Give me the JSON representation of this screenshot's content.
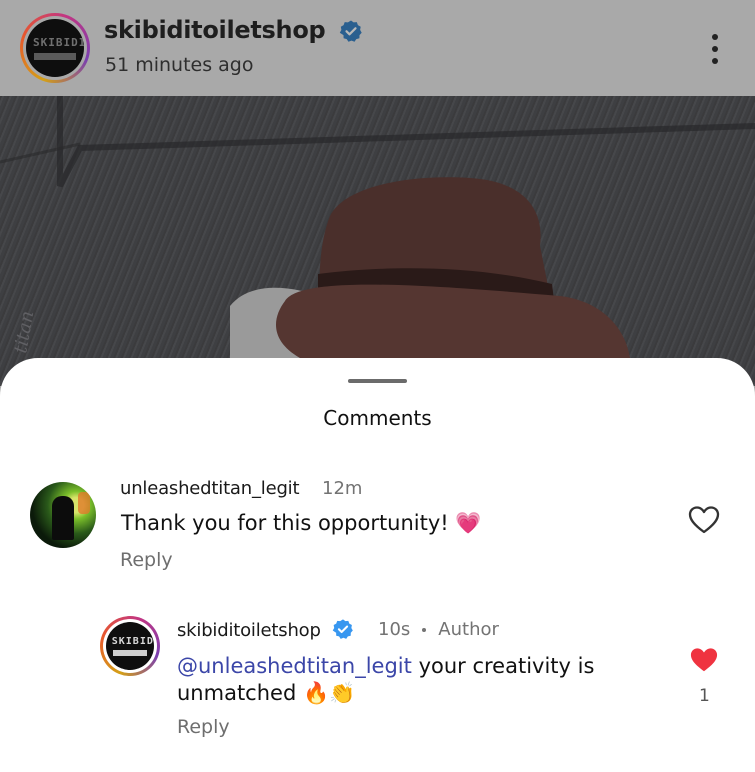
{
  "post": {
    "username": "skibiditoiletshop",
    "time": "51 minutes ago",
    "avatar_text": "SKIBIDI",
    "verified_icon": "verified-badge-icon",
    "menu_icon": "more-vertical-icon"
  },
  "sheet": {
    "title": "Comments"
  },
  "comments": [
    {
      "username": "unleashedtitan_legit",
      "time": "12m",
      "text": "Thank you for this opportunity! 💗",
      "reply_label": "Reply",
      "liked": false
    }
  ],
  "reply": {
    "username": "skibiditoiletshop",
    "time": "10s",
    "author_label": "Author",
    "mention": "@unleashedtitan_legit",
    "text_line1": " your creativity is",
    "text_line2": "unmatched 🔥👏",
    "reply_label": "Reply",
    "like_count": "1",
    "liked": true
  },
  "colors": {
    "mention": "#3b46a8",
    "like_red": "#ef3340",
    "verified_blue": "#3897f0"
  }
}
